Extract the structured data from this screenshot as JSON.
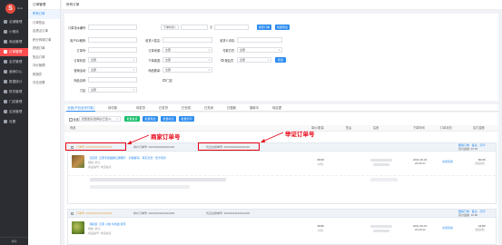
{
  "brand": {
    "logo_text": "S",
    "name": "Dolo"
  },
  "rail": {
    "items": [
      {
        "label": "店铺管理",
        "icon": "store-icon"
      },
      {
        "label": "小程序",
        "icon": "miniapp-icon"
      },
      {
        "label": "商品管理",
        "icon": "goods-icon"
      },
      {
        "label": "订单管理",
        "icon": "order-icon"
      },
      {
        "label": "会员管理",
        "icon": "member-icon"
      },
      {
        "label": "营销中心",
        "icon": "marketing-icon"
      },
      {
        "label": "数据统计",
        "icon": "data-icon"
      },
      {
        "label": "财务管理",
        "icon": "finance-icon"
      },
      {
        "label": "门店管理",
        "icon": "shop-icon"
      },
      {
        "label": "应用管理",
        "icon": "apps-icon"
      },
      {
        "label": "设置",
        "icon": "gear-icon"
      }
    ],
    "footer": "帮助"
  },
  "subnav": {
    "title": "订单管理",
    "items": [
      "所有订单",
      "订单售后",
      "自提点订单",
      "积分商城订单",
      "拼团订单",
      "售后订单",
      "评价管理",
      "核销员",
      "评论设置"
    ]
  },
  "breadcrumb": "所有订单",
  "filter": {
    "order_no_label": "订单流水编号:",
    "order_type": "下单时间",
    "date_sep": "至",
    "search_btn": "搜索订单",
    "export_btn": "批量导出",
    "buyer_label": "用户ID/昵称:",
    "consignee_label": "收货人姓名:",
    "consignee_phone_label": "收货人手机:",
    "order_no2_label": "订单号:",
    "source_label": "订单来源:",
    "source_value": "全部",
    "pay_method_label": "付款方式:",
    "pay_method_value": "全部",
    "order_status_label": "订单状态:",
    "order_status_value": "全部",
    "delivery_label": "下单渠道:",
    "delivery_value": "全部",
    "activity_label": "营销活动:",
    "activity_value": "全部",
    "amount_label": "商品数量:",
    "amount_value": "全部",
    "store_label": "门店:",
    "store_value": "全部",
    "vip_radio": "按会员",
    "store_radio": "门店",
    "filter_btn": "筛选",
    "goods_label": "商品名称:"
  },
  "tabs": [
    "全部(不包含未付款)",
    "待付款",
    "待发货",
    "已发货",
    "已完成",
    "已关闭",
    "已退款",
    "退款中",
    "待自提"
  ],
  "toolbar": {
    "select_all": "全选",
    "batch_select": "批量发货(选择后/已选 0)",
    "btn1": "批量发货",
    "btn2": "批量导出",
    "btn3": "批量标记",
    "btn4": "批量打印"
  },
  "columns": [
    "商品",
    "单价/数量",
    "售后",
    "买家",
    "下单时间",
    "订单状态",
    "实付金额"
  ],
  "orders": [
    {
      "order_id": "订单号: 20210620220016416",
      "merchant_no": "商户订单号: 20210620220016416",
      "proof_no": "凭证交易单号: 20210620220016416",
      "header_right": "删除订单 · 备注 · 打印",
      "header_right2": "实付金额: 60.00",
      "title": "【自营】云南专版甜脆红果椰汁 · 清爽解渴 · 真实天然 · 低卡营养",
      "spec": "规格: 默认",
      "meta": "商品编号: 未自提点",
      "price": "30.00",
      "qty": "(2件)",
      "time_date": "2021-06-20",
      "time_clock": "22:00:17",
      "status": "交易完成",
      "paid": "60.00",
      "paid_note": "(含运费)"
    },
    {
      "order_id": "订单号: 20210615162012003",
      "merchant_no": "商户订单号: 20210615162012003",
      "proof_no": "凭证交易单号: 20210615162012003",
      "header_right": "删除订单 · 备注 · 打印",
      "header_right2": "实付金额: 16.80",
      "title": "【精选】云南 小柑 牛奶甜 蜜枣",
      "spec": "规格: 默认",
      "meta": "商品编号: 未自提点",
      "price": "16.80",
      "qty": "(1件)",
      "time_date": "2021-06-15",
      "time_clock": "16:20:12",
      "status": "交易完成",
      "paid": "16.80",
      "paid_note": "(含运费)"
    }
  ],
  "annotations": {
    "merchant_order": "商家订单号",
    "proof_order": "举证订单号"
  },
  "colors": {
    "accent": "#2d8cf0",
    "rail_active": "#ff4d4f",
    "annotation": "#e60012"
  }
}
